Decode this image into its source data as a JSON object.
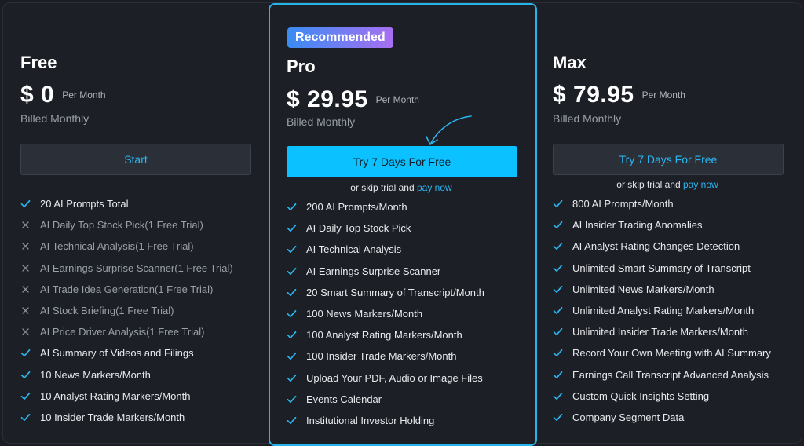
{
  "free": {
    "name": "Free",
    "price": "$ 0",
    "per": "Per Month",
    "billed": "Billed Monthly",
    "button": "Start",
    "features": [
      {
        "text": "20 AI Prompts Total",
        "included": true
      },
      {
        "text": "AI Daily Top Stock Pick(1 Free Trial)",
        "included": false
      },
      {
        "text": "AI Technical Analysis(1 Free Trial)",
        "included": false
      },
      {
        "text": "AI Earnings Surprise Scanner(1 Free Trial)",
        "included": false
      },
      {
        "text": "AI Trade Idea Generation(1 Free Trial)",
        "included": false
      },
      {
        "text": "AI Stock Briefing(1 Free Trial)",
        "included": false
      },
      {
        "text": "AI Price Driver Analysis(1 Free Trial)",
        "included": false
      },
      {
        "text": "AI Summary of Videos and Filings",
        "included": true
      },
      {
        "text": "10 News Markers/Month",
        "included": true
      },
      {
        "text": "10 Analyst Rating Markers/Month",
        "included": true
      },
      {
        "text": "10 Insider Trade Markers/Month",
        "included": true
      }
    ]
  },
  "pro": {
    "badge": "Recommended",
    "name": "Pro",
    "price": "$ 29.95",
    "per": "Per Month",
    "billed": "Billed Monthly",
    "button": "Try 7 Days For Free",
    "skip_text": "or skip trial and",
    "skip_link": "pay now",
    "features": [
      {
        "text": "200 AI Prompts/Month",
        "included": true
      },
      {
        "text": "AI Daily Top Stock Pick",
        "included": true
      },
      {
        "text": "AI Technical Analysis",
        "included": true
      },
      {
        "text": "AI Earnings Surprise Scanner",
        "included": true
      },
      {
        "text": "20 Smart Summary of Transcript/Month",
        "included": true
      },
      {
        "text": "100 News Markers/Month",
        "included": true
      },
      {
        "text": "100 Analyst Rating Markers/Month",
        "included": true
      },
      {
        "text": "100 Insider Trade Markers/Month",
        "included": true
      },
      {
        "text": "Upload Your PDF, Audio or Image Files",
        "included": true
      },
      {
        "text": "Events Calendar",
        "included": true
      },
      {
        "text": "Institutional Investor Holding",
        "included": true
      }
    ]
  },
  "max": {
    "name": "Max",
    "price": "$ 79.95",
    "per": "Per Month",
    "billed": "Billed Monthly",
    "button": "Try 7 Days For Free",
    "skip_text": "or skip trial and",
    "skip_link": "pay now",
    "features": [
      {
        "text": "800 AI Prompts/Month",
        "included": true
      },
      {
        "text": "AI Insider Trading Anomalies",
        "included": true
      },
      {
        "text": "AI Analyst Rating Changes Detection",
        "included": true
      },
      {
        "text": "Unlimited Smart Summary of Transcript",
        "included": true
      },
      {
        "text": "Unlimited News Markers/Month",
        "included": true
      },
      {
        "text": "Unlimited Analyst Rating Markers/Month",
        "included": true
      },
      {
        "text": "Unlimited Insider Trade Markers/Month",
        "included": true
      },
      {
        "text": "Record Your Own Meeting with AI Summary",
        "included": true
      },
      {
        "text": "Earnings Call Transcript Advanced Analysis",
        "included": true
      },
      {
        "text": "Custom Quick Insights Setting",
        "included": true
      },
      {
        "text": "Company Segment Data",
        "included": true
      }
    ]
  },
  "colors": {
    "accent": "#0bc1ff",
    "link": "#29b6f0",
    "check": "#29b6f0",
    "cross": "#8a9099",
    "badge_start": "#3a8cf2",
    "badge_end": "#a86ff2"
  }
}
